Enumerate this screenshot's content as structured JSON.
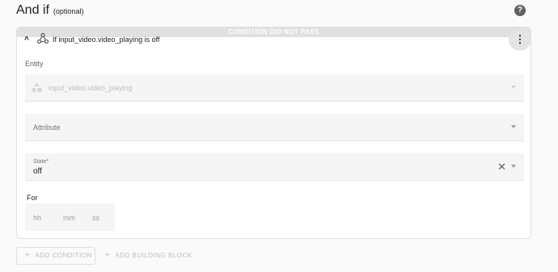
{
  "header": {
    "title": "And if",
    "optional": "(optional)",
    "help_icon": "help-circle-icon",
    "help_glyph": "?"
  },
  "condition": {
    "status_banner": "CONDITION DID NOT PASS",
    "title": "If input_video.video_playing is off",
    "collapse_glyph": "^",
    "menu_glyph": "⋮",
    "entity": {
      "label": "Entity",
      "value": "input_video.video_playing",
      "icon": "shapes-icon"
    },
    "attribute": {
      "placeholder": "Attribute"
    },
    "state": {
      "label": "State*",
      "value": "off",
      "clear_glyph": "✕"
    },
    "for": {
      "label": "For",
      "hh": "hh",
      "mm": "mm",
      "ss": "ss"
    }
  },
  "actions": {
    "add_condition": "ADD CONDITION",
    "add_building_block": "ADD BUILDING BLOCK",
    "plus_glyph": "+"
  },
  "colors": {
    "banner": "#e0e0e0",
    "field_bg": "#f5f5f5",
    "text": "#212121",
    "muted": "#9e9e9e"
  }
}
